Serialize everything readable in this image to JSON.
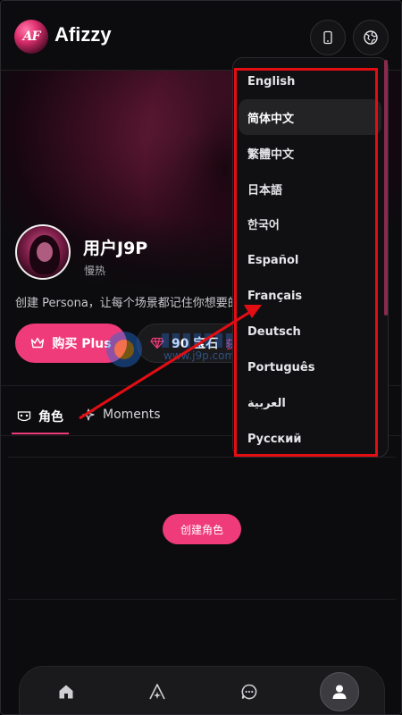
{
  "header": {
    "logo_mark": "AF",
    "app_name": "Afizzy"
  },
  "profile": {
    "username": "用户J9P",
    "subtitle": "慢热",
    "persona_text": "创建 Persona，让每个场景都记住你想要的"
  },
  "actions": {
    "plus_label": "购买 Plus",
    "gems_label": "90 宝石",
    "gems_get_label": "获"
  },
  "watermark": {
    "url": "www.j9p.com"
  },
  "tabs": [
    {
      "label": "角色",
      "icon": "mask-icon"
    },
    {
      "label": "Moments",
      "icon": "sparkle-icon"
    }
  ],
  "content": {
    "create_role_label": "创建角色"
  },
  "bottom_nav": [
    {
      "name": "home",
      "icon": "home-icon"
    },
    {
      "name": "explore",
      "icon": "explore-icon"
    },
    {
      "name": "chat",
      "icon": "chat-icon"
    },
    {
      "name": "profile",
      "icon": "user-icon"
    }
  ],
  "language_menu": {
    "items": [
      "English",
      "简体中文",
      "繁體中文",
      "日本語",
      "한국어",
      "Español",
      "Français",
      "Deutsch",
      "Português",
      "العربية",
      "Русский"
    ],
    "selected": "简体中文"
  },
  "colors": {
    "accent": "#ef3b79",
    "annotation": "#e30d14",
    "background": "#0c0c0e"
  }
}
